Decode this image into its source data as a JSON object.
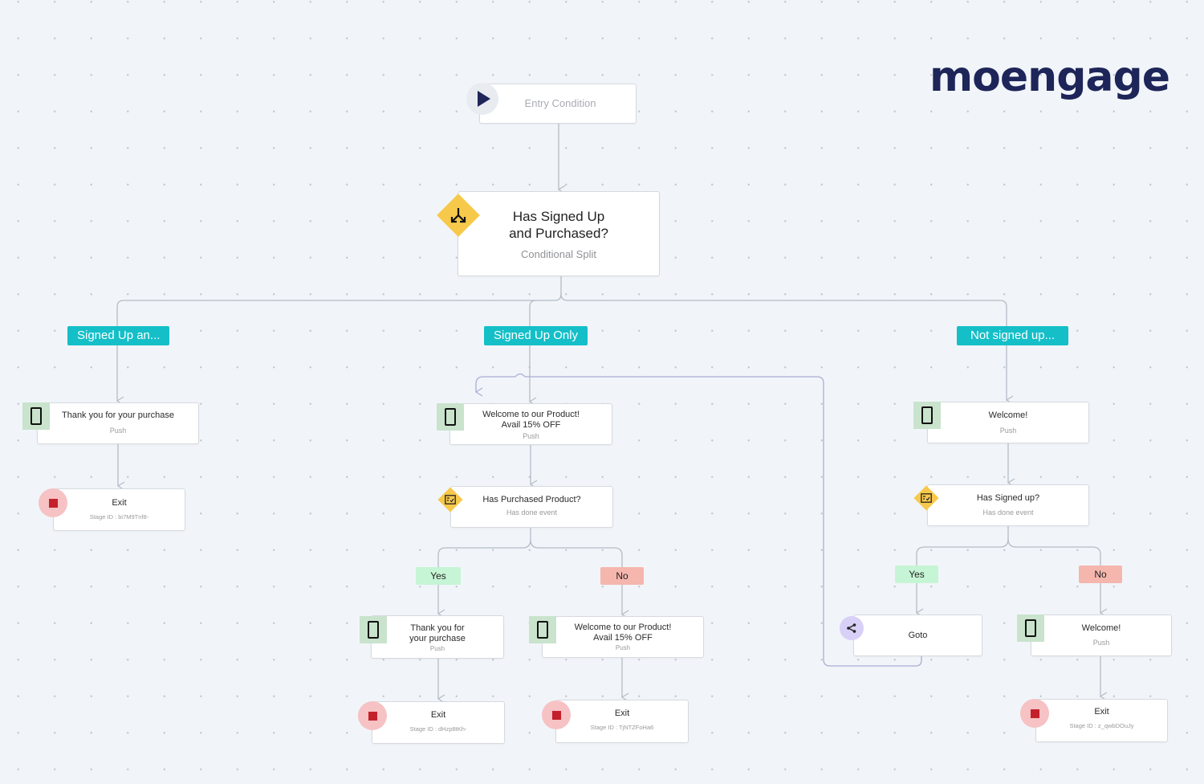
{
  "brand": {
    "logo_text": "moengage",
    "color": "#1e2559"
  },
  "entry": {
    "label": "Entry Condition",
    "icon": "play-icon"
  },
  "root_split": {
    "title_line1": "Has Signed Up",
    "title_line2": "and Purchased?",
    "type": "Conditional Split",
    "icon": "split-icon"
  },
  "branches": [
    {
      "label": "Signed Up an..."
    },
    {
      "label": "Signed Up Only"
    },
    {
      "label": "Not signed up..."
    }
  ],
  "branch1": {
    "push": {
      "title": "Thank you for your purchase",
      "channel": "Push"
    },
    "exit": {
      "title": "Exit",
      "stage_id": "Stage ID : bi7M9Tnf8-"
    }
  },
  "branch2": {
    "push": {
      "title_line1": "Welcome to our Product!",
      "title_line2": "Avail 15% OFF",
      "channel": "Push"
    },
    "condition": {
      "title": "Has Purchased Product?",
      "type": "Has done event"
    },
    "yes": {
      "label": "Yes",
      "push": {
        "title_line1": "Thank you for",
        "title_line2": "your purchase",
        "channel": "Push"
      },
      "exit": {
        "title": "Exit",
        "stage_id": "Stage ID : dHzp8tKh-"
      }
    },
    "no": {
      "label": "No",
      "push": {
        "title_line1": "Welcome to our Product!",
        "title_line2": "Avail 15% OFF",
        "channel": "Push"
      },
      "exit": {
        "title": "Exit",
        "stage_id": "Stage ID : TjNTZFoHa6"
      }
    }
  },
  "branch3": {
    "push": {
      "title": "Welcome!",
      "channel": "Push"
    },
    "condition": {
      "title": "Has Signed up?",
      "type": "Has done event"
    },
    "yes": {
      "label": "Yes",
      "goto": {
        "title": "Goto"
      }
    },
    "no": {
      "label": "No",
      "push": {
        "title": "Welcome!",
        "channel": "Push"
      },
      "exit": {
        "title": "Exit",
        "stage_id": "Stage ID : z_qwbDOuJy"
      }
    }
  },
  "colors": {
    "branch_label": "#14bfc8",
    "yes": "#c6f5d5",
    "no": "#f5b6ad",
    "push_icon_bg": "#c9e3cd",
    "exit_icon_bg": "#f6c2c4",
    "exit_square": "#c4202b",
    "condition_diamond": "#f7c94b",
    "goto_icon_bg": "#d9d0f7"
  }
}
